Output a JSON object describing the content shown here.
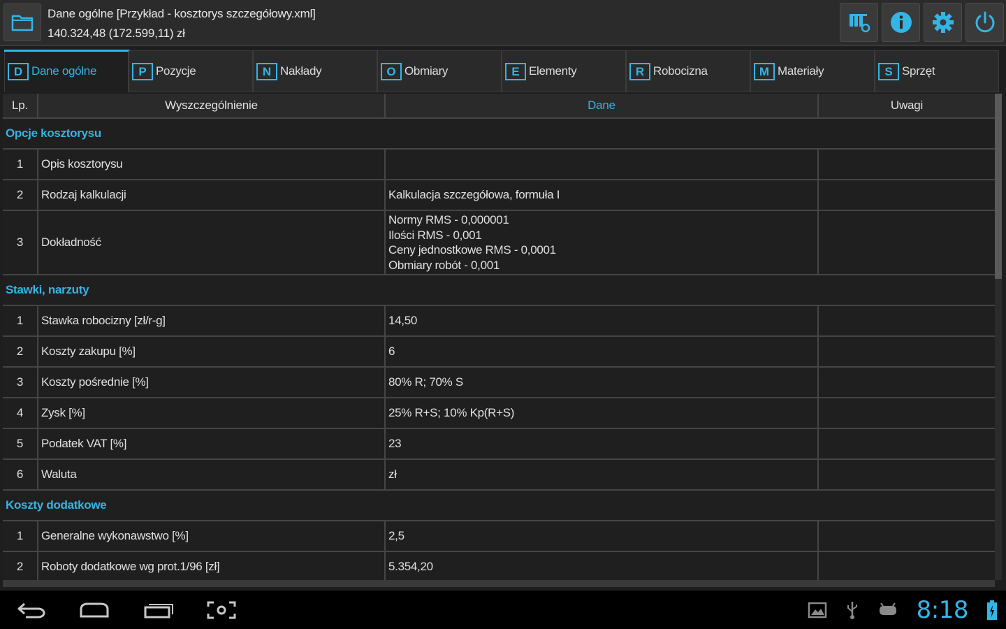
{
  "header": {
    "title": "Dane ogólne [Przykład - kosztorys szczegółowy.xml]",
    "total": "140.324,48 (172.599,11) zł",
    "buttons": [
      {
        "icon": "map-marker-icon"
      },
      {
        "icon": "info-icon"
      },
      {
        "icon": "gear-icon"
      },
      {
        "icon": "power-icon"
      }
    ]
  },
  "tabs": [
    {
      "letter": "D",
      "label": "Dane ogólne",
      "active": true
    },
    {
      "letter": "P",
      "label": "Pozycje"
    },
    {
      "letter": "N",
      "label": "Nakłady"
    },
    {
      "letter": "O",
      "label": "Obmiary"
    },
    {
      "letter": "E",
      "label": "Elementy"
    },
    {
      "letter": "R",
      "label": "Robocizna"
    },
    {
      "letter": "M",
      "label": "Materiały"
    },
    {
      "letter": "S",
      "label": "Sprzęt"
    }
  ],
  "table": {
    "columns": [
      "Lp.",
      "Wyszczególnienie",
      "Dane",
      "Uwagi"
    ],
    "sections": [
      {
        "title": "Opcje kosztorysu",
        "rows": [
          {
            "lp": "1",
            "name": "Opis kosztorysu",
            "value": "",
            "note": ""
          },
          {
            "lp": "2",
            "name": "Rodzaj kalkulacji",
            "value": "Kalkulacja szczegółowa, formuła I",
            "note": ""
          },
          {
            "lp": "3",
            "name": "Dokładność",
            "value_lines": [
              "Normy RMS - 0,000001",
              "Ilości RMS - 0,001",
              "Ceny jednostkowe RMS - 0,0001",
              "Obmiary robót - 0,001"
            ],
            "note": ""
          }
        ]
      },
      {
        "title": "Stawki, narzuty",
        "rows": [
          {
            "lp": "1",
            "name": "Stawka robocizny [zł/r-g]",
            "value": "14,50",
            "note": ""
          },
          {
            "lp": "2",
            "name": "Koszty zakupu [%]",
            "value": "6",
            "note": ""
          },
          {
            "lp": "3",
            "name": "Koszty pośrednie [%]",
            "value": "80% R; 70% S",
            "note": ""
          },
          {
            "lp": "4",
            "name": "Zysk [%]",
            "value": "25% R+S; 10% Kp(R+S)",
            "note": ""
          },
          {
            "lp": "5",
            "name": "Podatek VAT [%]",
            "value": "23",
            "note": ""
          },
          {
            "lp": "6",
            "name": "Waluta",
            "value": "zł",
            "note": ""
          }
        ]
      },
      {
        "title": "Koszty dodatkowe",
        "rows": [
          {
            "lp": "1",
            "name": "Generalne wykonawstwo [%]",
            "value": "2,5",
            "note": ""
          },
          {
            "lp": "2",
            "name": "Roboty dodatkowe wg prot.1/96 [zł]",
            "value": "5.354,20",
            "note": ""
          }
        ]
      }
    ]
  },
  "navbar": {
    "clock": "8:18",
    "accent_color": "#33b5e5"
  }
}
